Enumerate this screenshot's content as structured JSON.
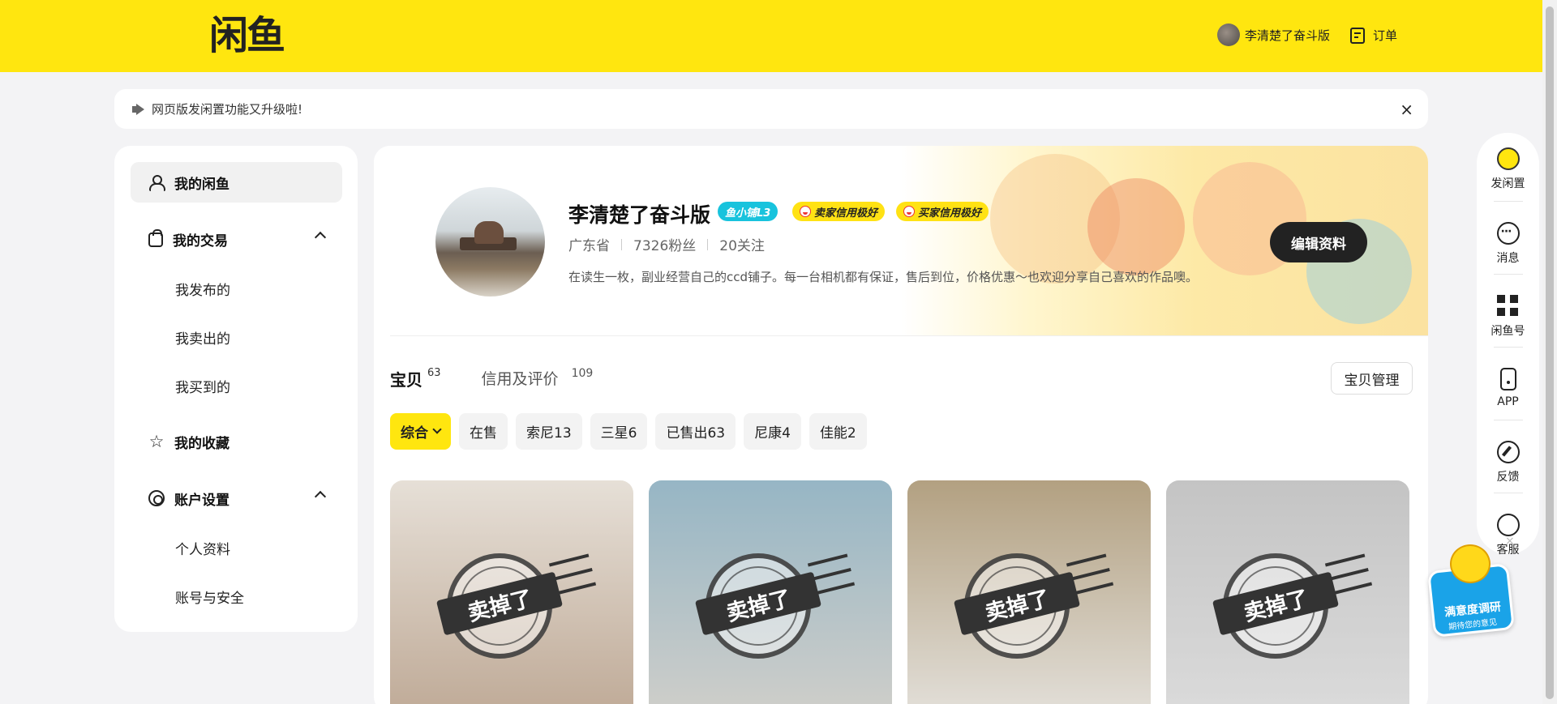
{
  "header": {
    "logo_text": "闲鱼",
    "username": "李清楚了奋斗版",
    "orders_label": "订单"
  },
  "notice": {
    "text": "网页版发闲置功能又升级啦!",
    "close": "×"
  },
  "sidebar": {
    "my_xianyu": "我的闲鱼",
    "my_trades": "我的交易",
    "trade_items": [
      "我发布的",
      "我卖出的",
      "我买到的"
    ],
    "my_favorites": "我的收藏",
    "account_settings": "账户设置",
    "account_items": [
      "个人资料",
      "账号与安全"
    ]
  },
  "profile": {
    "name": "李清楚了奋斗版",
    "badge_shop": "鱼小铺L3",
    "badge_seller": "卖家信用极好",
    "badge_buyer": "买家信用极好",
    "location": "广东省",
    "fans": "7326粉丝",
    "following": "20关注",
    "bio": "在读生一枚，副业经营自己的ccd铺子。每一台相机都有保证，售后到位，价格优惠～也欢迎分享自己喜欢的作品噢。",
    "edit_button": "编辑资料"
  },
  "tabs": {
    "items_label": "宝贝",
    "items_count": "63",
    "reviews_label": "信用及评价",
    "reviews_count": "109",
    "manage_button": "宝贝管理"
  },
  "filters": [
    "综合",
    "在售",
    "索尼13",
    "三星6",
    "已售出63",
    "尼康4",
    "佳能2"
  ],
  "products": [
    {
      "stamp": "卖掉了",
      "color_top": "#d9cfc2",
      "color_bottom": "#9b7a5c"
    },
    {
      "stamp": "卖掉了",
      "color_top": "#5f8fa6",
      "color_bottom": "#b9b6ae"
    },
    {
      "stamp": "卖掉了",
      "color_top": "#8a6e3e",
      "color_bottom": "#d6d2ca"
    },
    {
      "stamp": "卖掉了",
      "color_top": "#a5a5a5",
      "color_bottom": "#c9c9c9"
    }
  ],
  "right_toolbar": {
    "post": "发闲置",
    "messages": "消息",
    "xianyu_id": "闲鱼号",
    "app": "APP",
    "feedback": "反馈",
    "service": "客服"
  },
  "survey": {
    "title": "满意度调研",
    "subtitle": "期待您的意见",
    "close": "×"
  },
  "colors": {
    "brand_yellow": "#ffe60f",
    "badge_cyan": "#18c3dd",
    "dark_button": "#222222"
  }
}
